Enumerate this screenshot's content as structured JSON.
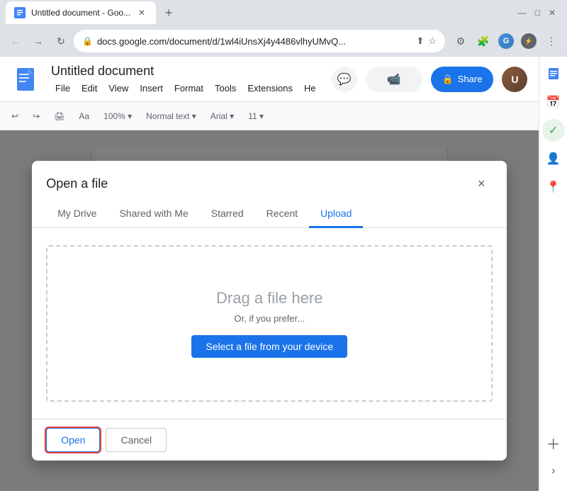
{
  "browser": {
    "tab_title": "Untitled document - Goo...",
    "tab_favicon": "G",
    "url": "docs.google.com/document/d/1wl4iUnsXj4y4486vlhyUMvQ...",
    "new_tab_icon": "+",
    "controls": {
      "minimize": "—",
      "maximize": "□",
      "close": "✕"
    },
    "nav": {
      "back": "←",
      "forward": "→",
      "reload": "↻"
    }
  },
  "docs": {
    "title": "Untitled document",
    "menu_items": [
      "File",
      "Edit",
      "View",
      "Insert",
      "Format",
      "Tools",
      "Extensions",
      "He"
    ],
    "toolbar": {
      "comments_icon": "💬",
      "meet_icon": "📹",
      "share_label": "Share",
      "share_icon": "🔒"
    },
    "format_bar": [
      "↩",
      "↪",
      "A",
      "Aa",
      "100%",
      "▾",
      "Normal text",
      "▾",
      "Arial",
      "▾"
    ],
    "right_sidebar_icons": [
      "☰",
      "🖊",
      "✓",
      "➕",
      "📍"
    ]
  },
  "dialog": {
    "title": "Open a file",
    "close_icon": "×",
    "tabs": [
      {
        "label": "My Drive",
        "active": false
      },
      {
        "label": "Shared with Me",
        "active": false
      },
      {
        "label": "Starred",
        "active": false
      },
      {
        "label": "Recent",
        "active": false
      },
      {
        "label": "Upload",
        "active": true
      }
    ],
    "drop_zone": {
      "title": "Drag a file here",
      "subtitle": "Or, if you prefer...",
      "select_btn": "Select a file from your device"
    },
    "footer": {
      "open_label": "Open",
      "cancel_label": "Cancel"
    }
  }
}
